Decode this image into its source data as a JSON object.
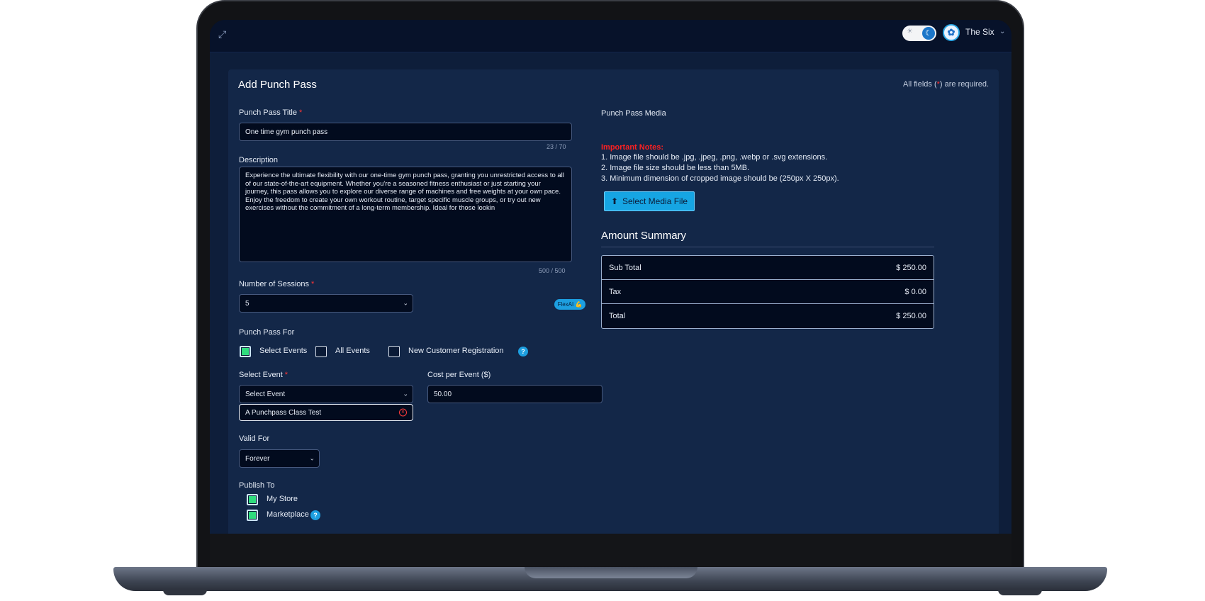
{
  "topbar": {
    "expand_icon": "expand-icon",
    "theme_toggle": {
      "icon_on": "moon-icon",
      "icon_off": "sun-icon",
      "mode": "dark"
    },
    "avatar_icon": "org-logo-icon",
    "user_name": "The Six"
  },
  "form": {
    "title": "Add Punch Pass",
    "required_note_prefix": "All fields (",
    "required_note_star": "*",
    "required_note_suffix": ") are required.",
    "title_field": {
      "label": "Punch Pass Title",
      "value": "One time gym punch pass",
      "counter": "23 / 70"
    },
    "description": {
      "label": "Description",
      "value": "Experience the ultimate flexibility with our one-time gym punch pass, granting you unrestricted access to all of our state-of-the-art equipment. Whether you're a seasoned fitness enthusiast or just starting your journey, this pass allows you to explore our diverse range of machines and free weights at your own pace. Enjoy the freedom to create your own workout routine, target specific muscle groups, or try out new exercises without the commitment of a long-term membership. Ideal for those lookin",
      "counter": "500 / 500",
      "ai_button": "FlexAI 💪"
    },
    "sessions": {
      "label": "Number of Sessions",
      "value": "5"
    },
    "pass_for": {
      "label": "Punch Pass For",
      "options": [
        {
          "label": "Select Events",
          "checked": true
        },
        {
          "label": "All Events",
          "checked": false
        },
        {
          "label": "New Customer Registration",
          "checked": false
        }
      ]
    },
    "select_event": {
      "label": "Select Event",
      "placeholder": "Select Event",
      "selected_tag": "A Punchpass Class Test"
    },
    "cost_per_event": {
      "label": "Cost per Event ($)",
      "value": "50.00"
    },
    "valid_for": {
      "label": "Valid For",
      "value": "Forever"
    },
    "publish_to": {
      "label": "Publish To",
      "options": [
        {
          "label": "My Store",
          "checked": true
        },
        {
          "label": "Marketplace",
          "checked": true
        }
      ]
    },
    "media": {
      "label": "Punch Pass Media",
      "notes_title": "Important Notes:",
      "notes": [
        "1. Image file should be .jpg, .jpeg, .png, .webp or .svg extensions.",
        "2. Image file size should be less than 5MB.",
        "3. Minimum dimension of cropped image should be (250px X 250px)."
      ],
      "button_label": "Select Media File"
    },
    "amount_summary": {
      "title": "Amount Summary",
      "rows": [
        {
          "label": "Sub Total",
          "value": "$ 250.00"
        },
        {
          "label": "Tax",
          "value": "$ 0.00"
        },
        {
          "label": "Total",
          "value": "$ 250.00"
        }
      ]
    }
  },
  "colors": {
    "accent": "#16a5e3",
    "required": "#ff2b2b",
    "checked": "#2fdc7d",
    "panel": "#132748"
  }
}
